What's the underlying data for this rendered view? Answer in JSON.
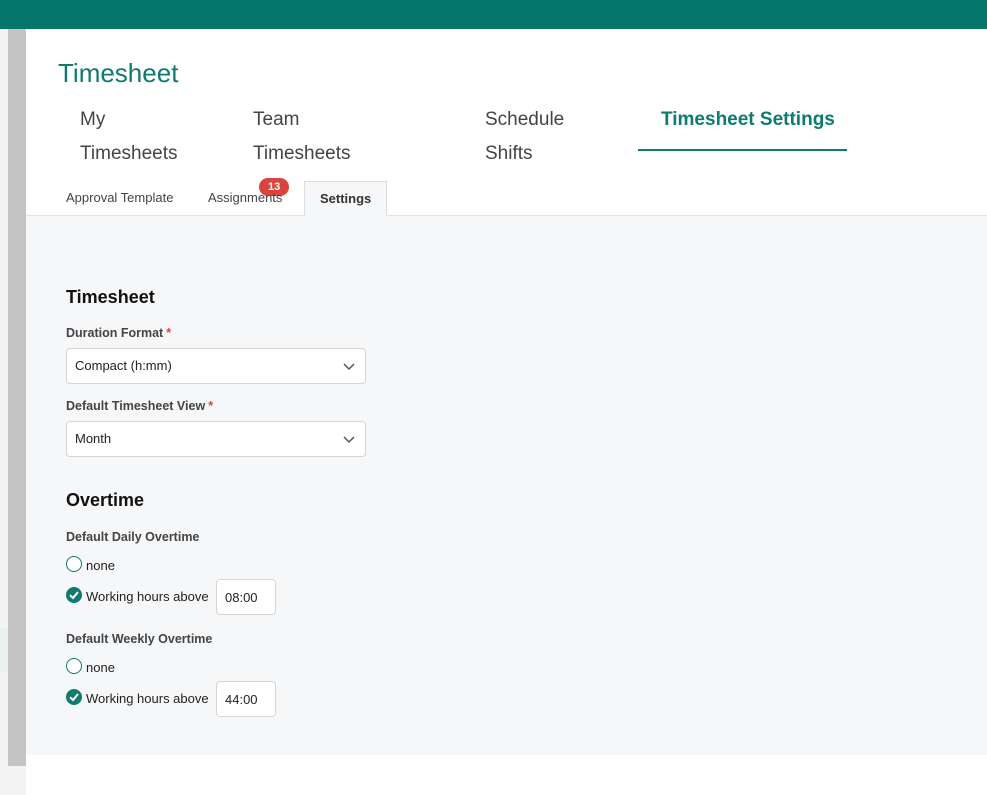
{
  "header": {
    "title": "Timesheet"
  },
  "main_tabs": [
    {
      "label": "My Timesheets"
    },
    {
      "label": "Team Timesheets",
      "badge": "13"
    },
    {
      "label": "Schedule Shifts"
    },
    {
      "label": "Timesheet Settings",
      "active": true
    }
  ],
  "sub_tabs": [
    {
      "label": "Approval Template"
    },
    {
      "label": "Assignments"
    },
    {
      "label": "Settings",
      "active": true
    }
  ],
  "timesheet": {
    "title": "Timesheet",
    "duration_format": {
      "label": "Duration Format",
      "required_mark": "*",
      "value": "Compact (h:mm)"
    },
    "default_view": {
      "label": "Default Timesheet View",
      "required_mark": "*",
      "value": "Month"
    }
  },
  "overtime": {
    "title": "Overtime",
    "daily": {
      "label": "Default Daily Overtime",
      "option_none": "none",
      "option_hours": "Working hours above",
      "selected": "hours",
      "hours_value": "08:00"
    },
    "weekly": {
      "label": "Default Weekly Overtime",
      "option_none": "none",
      "option_hours": "Working hours above",
      "selected": "hours",
      "hours_value": "44:00"
    }
  },
  "colors": {
    "brand": "#03756b",
    "accent": "#0f7a6f",
    "badge": "#d9453d"
  }
}
